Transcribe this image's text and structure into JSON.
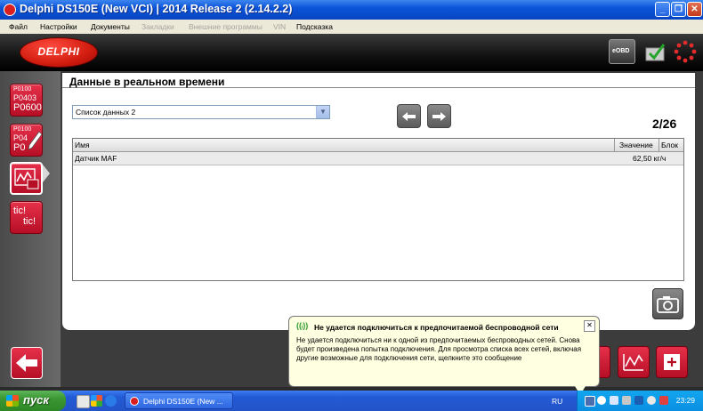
{
  "window": {
    "title": "Delphi DS150E (New VCI)  |  2014 Release 2 (2.14.2.2)",
    "minimize": "_",
    "maximize": "❐",
    "close": "✕"
  },
  "menu": {
    "items": [
      {
        "label": "Файл",
        "enabled": true
      },
      {
        "label": "Настройки",
        "enabled": true
      },
      {
        "label": "Документы",
        "enabled": true
      },
      {
        "label": "Закладки",
        "enabled": false
      },
      {
        "label": "Внешние программы",
        "enabled": false
      },
      {
        "label": "VIN",
        "enabled": false
      },
      {
        "label": "Подсказка",
        "enabled": true
      }
    ]
  },
  "header": {
    "logo_text": "DELPHI",
    "eobd_label": "eOBD"
  },
  "sidebar": {
    "dtc_read_lines": [
      "P0100",
      "P0403",
      "P0600"
    ],
    "dtc_clear_lines": [
      "P0100",
      "P04",
      "P0"
    ],
    "tic_lines": [
      "tic!",
      "tic!"
    ]
  },
  "panel": {
    "title": "Данные в реальном времени",
    "data_list_select": "Список данных 2",
    "page_counter": "2/26",
    "columns": {
      "name": "Имя",
      "value": "Значение",
      "block": "Блок"
    },
    "rows": [
      {
        "name": "Датчик MAF",
        "value": "62,50 кг/ч",
        "block": ""
      }
    ]
  },
  "balloon": {
    "title": "Не удается подключиться к предпочитаемой беспроводной сети",
    "body": "Не удается подключиться ни к одной из предпочитаемых беспроводных сетей. Снова будет произведена попытка подключения. Для просмотра списка всех сетей, включая другие возможные для подключения сети, щелкните это сообщение",
    "close": "✕"
  },
  "taskbar": {
    "start_label": "пуск",
    "task_label": "Delphi DS150E (New ...",
    "language": "RU",
    "clock": "23:29"
  },
  "colors": {
    "accent_red": "#d11c10",
    "titlebar_blue": "#0b54d8",
    "start_green": "#3a9632",
    "tray_blue": "#0a8ee1"
  }
}
